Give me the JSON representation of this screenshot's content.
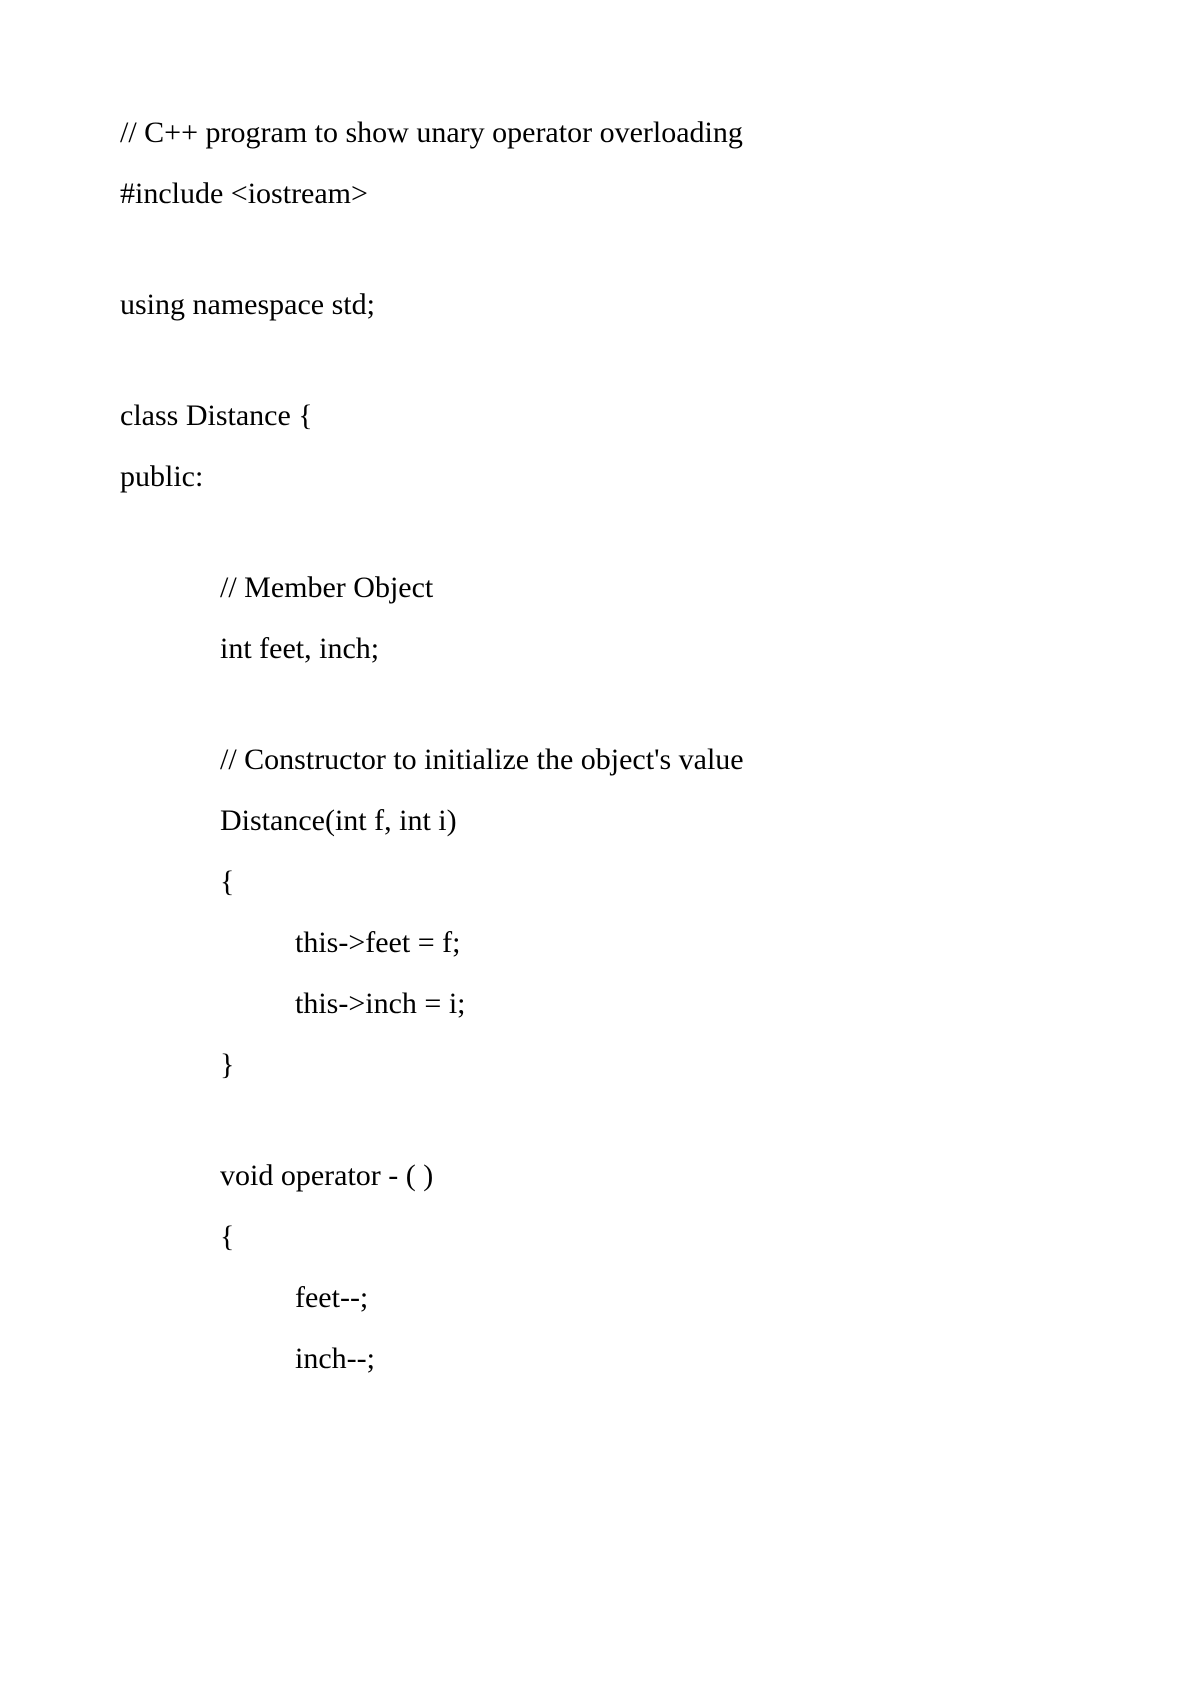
{
  "code": {
    "lines": [
      {
        "text": "// C++ program to show unary operator overloading",
        "indent": 0,
        "blank": false
      },
      {
        "text": "#include <iostream>",
        "indent": 0,
        "blank": false
      },
      {
        "text": "",
        "indent": 0,
        "blank": true
      },
      {
        "text": "using namespace std;",
        "indent": 0,
        "blank": false
      },
      {
        "text": "",
        "indent": 0,
        "blank": true
      },
      {
        "text": "class Distance {",
        "indent": 0,
        "blank": false
      },
      {
        "text": "public:",
        "indent": 0,
        "blank": false
      },
      {
        "text": "",
        "indent": 0,
        "blank": true
      },
      {
        "text": "// Member Object",
        "indent": 1,
        "blank": false
      },
      {
        "text": "int feet, inch;",
        "indent": 1,
        "blank": false
      },
      {
        "text": "",
        "indent": 0,
        "blank": true
      },
      {
        "text": "// Constructor to initialize the object's value",
        "indent": 1,
        "blank": false
      },
      {
        "text": "Distance(int f, int i)",
        "indent": 1,
        "blank": false
      },
      {
        "text": "{",
        "indent": 1,
        "blank": false
      },
      {
        "text": "this->feet = f;",
        "indent": 2,
        "blank": false
      },
      {
        "text": "this->inch = i;",
        "indent": 2,
        "blank": false
      },
      {
        "text": "}",
        "indent": 1,
        "blank": false
      },
      {
        "text": "",
        "indent": 0,
        "blank": true
      },
      {
        "text": "void operator - ( )",
        "indent": 1,
        "blank": false
      },
      {
        "text": "{",
        "indent": 1,
        "blank": false
      },
      {
        "text": "feet--;",
        "indent": 2,
        "blank": false
      },
      {
        "text": "inch--;",
        "indent": 2,
        "blank": false
      }
    ]
  }
}
